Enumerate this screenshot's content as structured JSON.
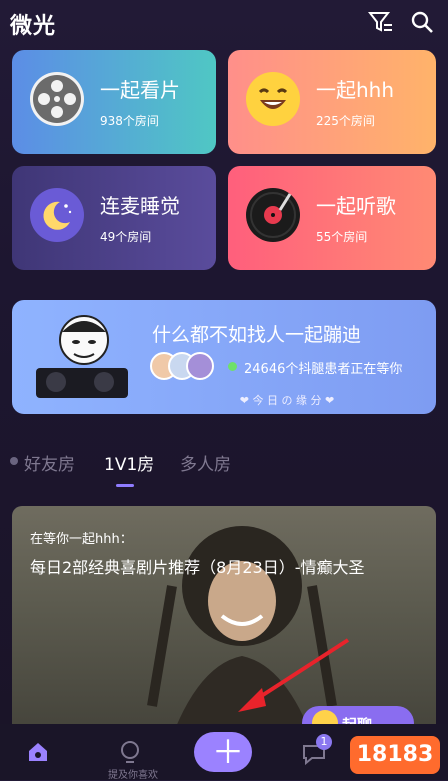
{
  "header": {
    "title": "微光",
    "filter_icon": "filter-icon",
    "search_icon": "search-icon"
  },
  "cards": [
    {
      "title": "一起看片",
      "sub": "938个房间",
      "icon": "film-reel-icon"
    },
    {
      "title": "一起hhh",
      "sub": "225个房间",
      "icon": "laughing-emoji-icon"
    },
    {
      "title": "连麦睡觉",
      "sub": "49个房间",
      "icon": "moon-icon"
    },
    {
      "title": "一起听歌",
      "sub": "55个房间",
      "icon": "vinyl-record-icon"
    }
  ],
  "banner": {
    "title": "什么都不如找人一起蹦迪",
    "sub": "24646个抖腿患者正在等你",
    "footer": "❤ 今 日 の 缘 分 ❤"
  },
  "tabs": [
    "好友房",
    "1V1房",
    "多人房"
  ],
  "room": {
    "waiting": "在等你一起hhh：",
    "title": "每日2部经典喜剧片推荐（8月23日）-情癫大圣",
    "badge": "起聊"
  },
  "nav": {
    "bulb_label": "提及你喜欢",
    "badge_count": "1",
    "watermark": "18183"
  },
  "colors": {
    "accent": "#9b82ff",
    "background": "#1d1630"
  }
}
